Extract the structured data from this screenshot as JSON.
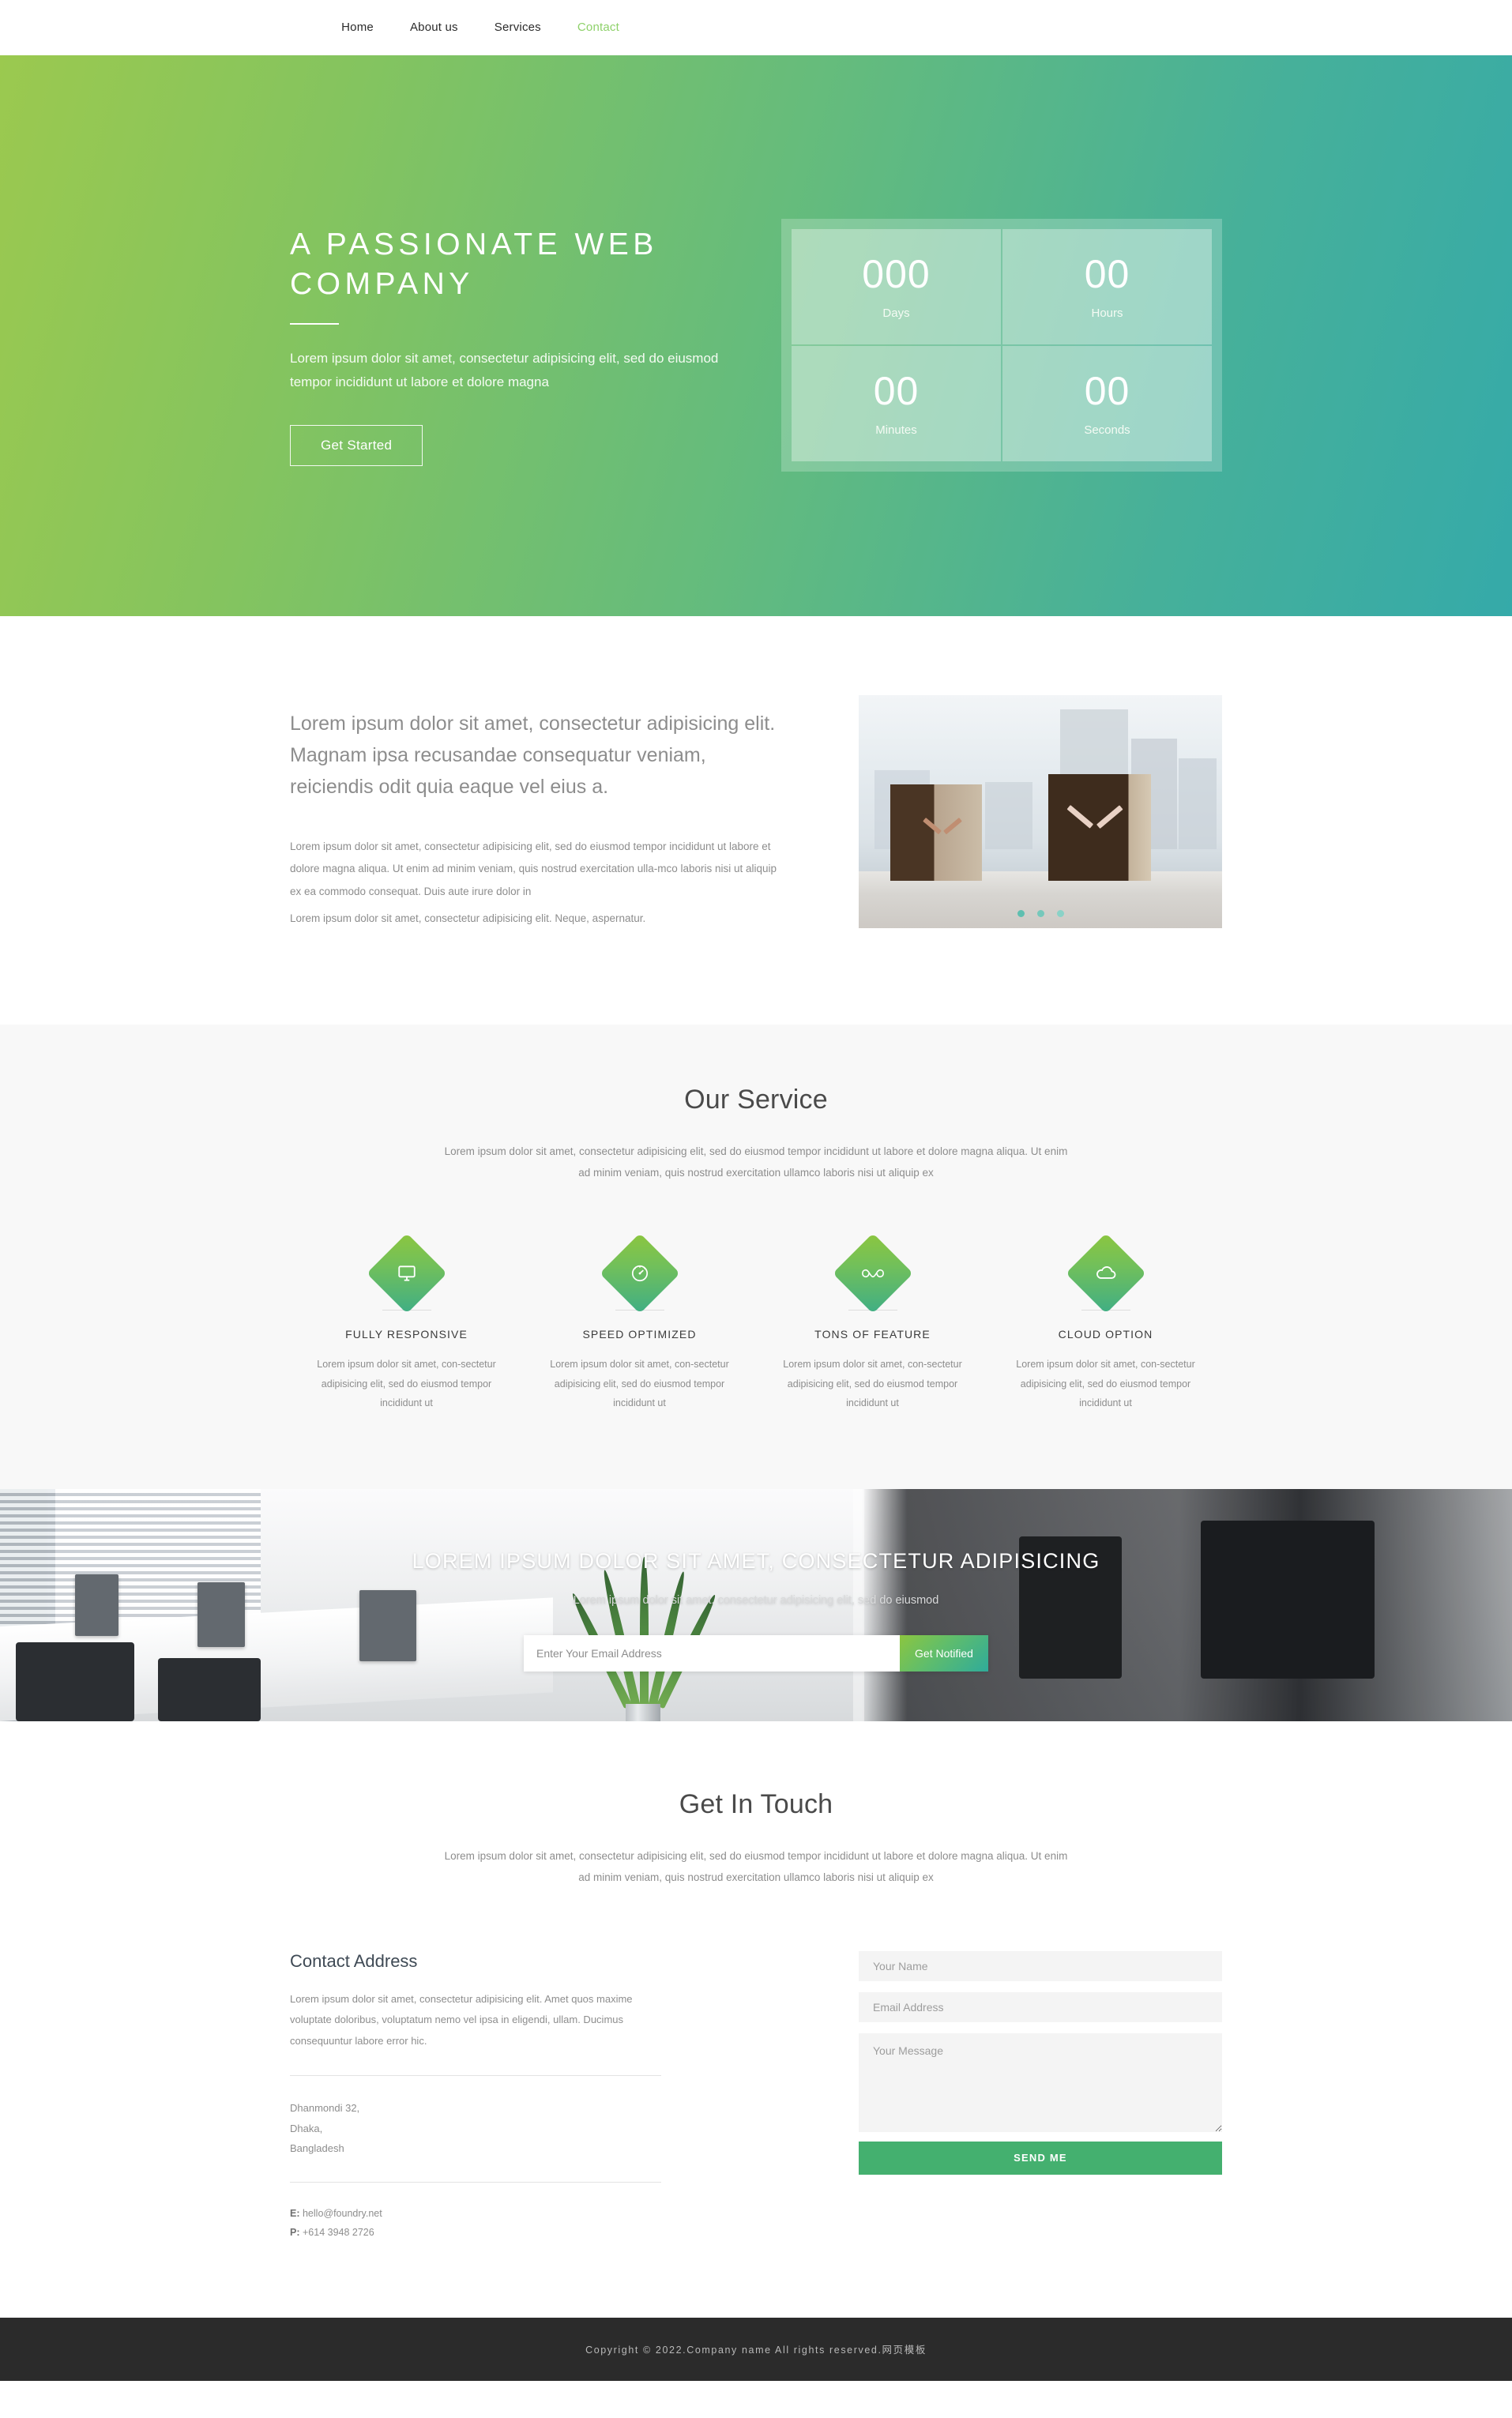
{
  "nav": {
    "items": [
      {
        "label": "Home",
        "active": false
      },
      {
        "label": "About us",
        "active": false
      },
      {
        "label": "Services",
        "active": false
      },
      {
        "label": "Contact",
        "active": true
      }
    ],
    "accent_color": "#8ed16a"
  },
  "hero": {
    "title": "A PASSIONATE WEB COMPANY",
    "subtitle": "Lorem ipsum dolor sit amet, consectetur adipisicing elit, sed do eiusmod tempor incididunt ut labore et dolore magna",
    "button": "Get Started",
    "gradient_from": "#9bc94f",
    "gradient_to": "#35aaa9",
    "countdown": [
      {
        "value": "000",
        "label": "Days"
      },
      {
        "value": "00",
        "label": "Hours"
      },
      {
        "value": "00",
        "label": "Minutes"
      },
      {
        "value": "00",
        "label": "Seconds"
      }
    ]
  },
  "about": {
    "heading": "Lorem ipsum dolor sit amet, consectetur adipisicing elit. Magnam ipsa recusandae consequatur veniam, reiciendis odit quia eaque vel eius a.",
    "paragraph1": "Lorem ipsum dolor sit amet, consectetur adipisicing elit, sed do eiusmod tempor incididunt ut labore et dolore magna aliqua. Ut enim ad minim veniam, quis nostrud exercitation ulla-mco laboris nisi ut aliquip ex ea commodo consequat. Duis aute irure dolor in",
    "paragraph2": "Lorem ipsum dolor sit amet, consectetur adipisicing elit. Neque, aspernatur.",
    "image_alt": "wooden-clock-product-photo",
    "slider_dots": 3,
    "active_dot": 0
  },
  "service": {
    "title": "Our Service",
    "subtitle": "Lorem ipsum dolor sit amet, consectetur adipisicing elit, sed do eiusmod tempor incididunt ut labore et dolore magna aliqua. Ut enim ad minim veniam, quis nostrud exercitation ullamco laboris nisi ut aliquip ex",
    "cards": [
      {
        "icon": "monitor-icon",
        "title": "FULLY RESPONSIVE",
        "text": "Lorem ipsum dolor sit amet, con-sectetur adipisicing elit, sed do eiusmod tempor incididunt ut"
      },
      {
        "icon": "speedometer-icon",
        "title": "SPEED OPTIMIZED",
        "text": "Lorem ipsum dolor sit amet, con-sectetur adipisicing elit, sed do eiusmod tempor incididunt ut"
      },
      {
        "icon": "infinity-icon",
        "title": "TONS OF FEATURE",
        "text": "Lorem ipsum dolor sit amet, con-sectetur adipisicing elit, sed do eiusmod tempor incididunt ut"
      },
      {
        "icon": "cloud-icon",
        "title": "CLOUD OPTION",
        "text": "Lorem ipsum dolor sit amet, con-sectetur adipisicing elit, sed do eiusmod tempor incididunt ut"
      }
    ]
  },
  "cta": {
    "title": "LOREM IPSUM DOLOR SIT AMET, CONSECTETUR ADIPISICING",
    "subtitle": "Lorem ipsum dolor sit amet, consectetur adipisicing elit, sed do eiusmod",
    "email_placeholder": "Enter Your Email Address",
    "button": "Get Notified",
    "background_alt": "office-interior-photo"
  },
  "contact": {
    "title": "Get In Touch",
    "subtitle": "Lorem ipsum dolor sit amet, consectetur adipisicing elit, sed do eiusmod tempor incididunt ut labore et dolore magna aliqua. Ut enim ad minim veniam, quis nostrud exercitation ullamco laboris nisi ut aliquip ex",
    "address_heading": "Contact Address",
    "address_paragraph": "Lorem ipsum dolor sit amet, consectetur adipisicing elit. Amet quos maxime voluptate doloribus, voluptatum nemo vel ipsa in eligendi, ullam. Ducimus consequuntur labore error hic.",
    "address_line1": "Dhanmondi 32,",
    "address_line2": "Dhaka,",
    "address_line3": "Bangladesh",
    "email_label": "E:",
    "email_value": "hello@foundry.net",
    "phone_label": "P:",
    "phone_value": "+614 3948 2726",
    "form": {
      "name_placeholder": "Your Name",
      "email_placeholder": "Email Address",
      "message_placeholder": "Your Message",
      "submit_label": "SEND ME",
      "submit_color": "#44b06f"
    }
  },
  "footer": {
    "text": "Copyright © 2022.Company name All rights reserved.网页模板",
    "background": "#2b2b2b"
  }
}
